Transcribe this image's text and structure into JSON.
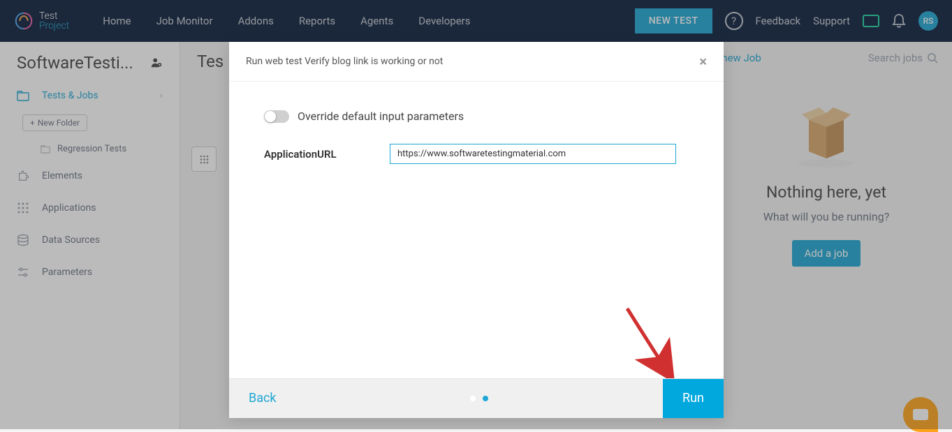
{
  "logo": {
    "top": "Test",
    "bottom": "Project"
  },
  "nav": {
    "home": "Home",
    "job_monitor": "Job Monitor",
    "addons": "Addons",
    "reports": "Reports",
    "agents": "Agents",
    "developers": "Developers"
  },
  "header": {
    "new_test": "NEW TEST",
    "feedback": "Feedback",
    "support": "Support",
    "avatar": "RS"
  },
  "sidebar": {
    "project_title": "SoftwareTesti...",
    "items": {
      "tests_jobs": "Tests & Jobs",
      "new_folder": "New Folder",
      "regression_tests": "Regression Tests",
      "elements": "Elements",
      "applications": "Applications",
      "data_sources": "Data Sources",
      "parameters": "Parameters"
    }
  },
  "content": {
    "title": "Tes"
  },
  "right": {
    "add_new_job": "Add a new Job",
    "search_placeholder": "Search jobs",
    "empty_title": "Nothing here, yet",
    "empty_subtitle": "What will you be running?",
    "add_job_btn": "Add a job"
  },
  "modal": {
    "title": "Run web test Verify blog link is working or not",
    "override_label": "Override default input parameters",
    "param_label": "ApplicationURL",
    "param_value": "https://www.softwaretestingmaterial.com",
    "back": "Back",
    "run": "Run"
  }
}
